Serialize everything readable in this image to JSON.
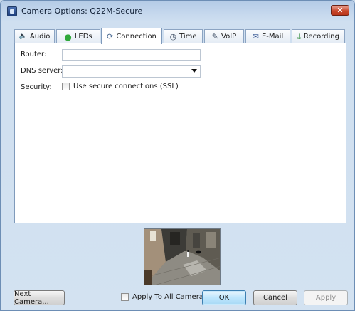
{
  "window": {
    "title": "Camera Options: Q22M-Secure",
    "close_label": "✕"
  },
  "tabs": [
    {
      "label": "Audio",
      "icon": "speaker-icon",
      "glyph": "🔈"
    },
    {
      "label": "LEDs",
      "icon": "green-led-icon",
      "glyph": "●"
    },
    {
      "label": "Connection",
      "icon": "connection-icon",
      "glyph": "⟳"
    },
    {
      "label": "Time",
      "icon": "clock-icon",
      "glyph": "◷"
    },
    {
      "label": "VoIP",
      "icon": "pen-icon",
      "glyph": "✎"
    },
    {
      "label": "E-Mail",
      "icon": "envelope-icon",
      "glyph": "✉"
    },
    {
      "label": "Recording",
      "icon": "recording-icon",
      "glyph": "⤓"
    }
  ],
  "active_tab": "Connection",
  "connection": {
    "router_label": "Router:",
    "router_value": "",
    "dns_label": "DNS server:",
    "dns_value": "",
    "security_label": "Security:",
    "ssl_label": "Use secure connections (SSL)",
    "ssl_checked": false
  },
  "footer": {
    "next_camera": "Next Camera...",
    "apply_all": "Apply To All Cameras",
    "apply_all_checked": false,
    "ok": "OK",
    "cancel": "Cancel",
    "apply": "Apply"
  },
  "colors": {
    "led_green": "#2fa83a",
    "accent_blue": "#3c7fb1",
    "close_red": "#c9472b"
  }
}
